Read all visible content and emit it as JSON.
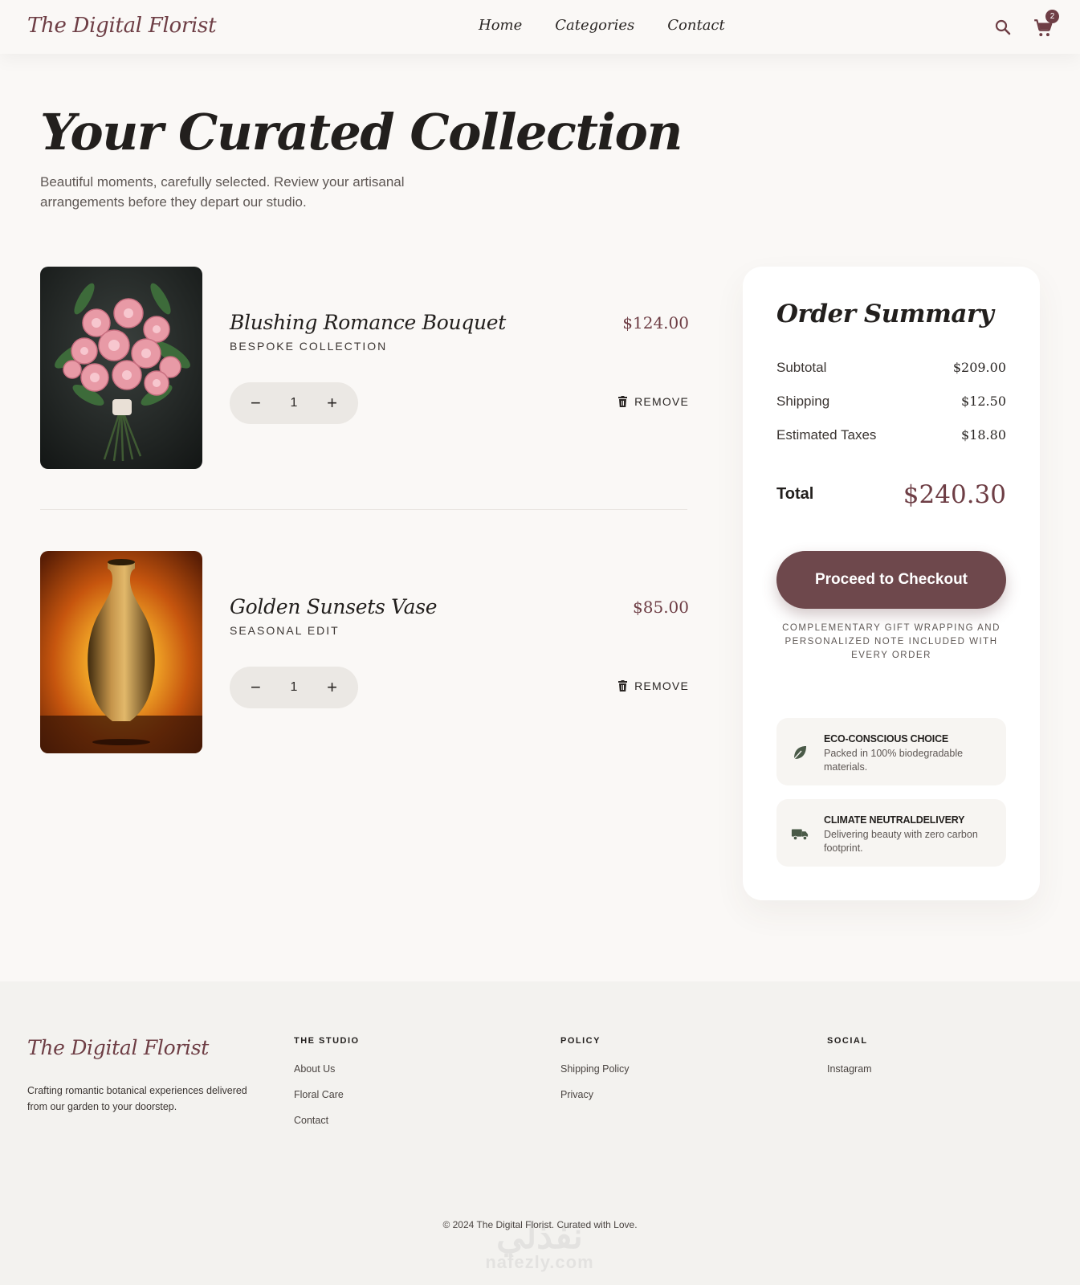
{
  "nav": {
    "brand": "The Digital Florist",
    "links": [
      "Home",
      "Categories",
      "Contact"
    ],
    "cart_count": "2"
  },
  "hero": {
    "title": "Your Curated Collection",
    "subtitle": "Beautiful moments, carefully selected. Review your artisanal arrangements before they depart our studio."
  },
  "cart": {
    "items": [
      {
        "name": "Blushing Romance Bouquet",
        "collection": "BESPOKE COLLECTION",
        "price": "$124.00",
        "quantity": "1",
        "remove_label": "REMOVE",
        "decrement": "−",
        "increment": "+"
      },
      {
        "name": "Golden Sunsets Vase",
        "collection": "SEASONAL EDIT",
        "price": "$85.00",
        "quantity": "1",
        "remove_label": "REMOVE",
        "decrement": "−",
        "increment": "+"
      }
    ]
  },
  "summary": {
    "title": "Order Summary",
    "rows": [
      {
        "label": "Subtotal",
        "value": "$209.00"
      },
      {
        "label": "Shipping",
        "value": "$12.50"
      },
      {
        "label": "Estimated Taxes",
        "value": "$18.80"
      }
    ],
    "total_label": "Total",
    "total_value": "$240.30",
    "checkout_label": "Proceed to Checkout",
    "gift_note": "COMPLEMENTARY GIFT WRAPPING AND PERSONALIZED NOTE INCLUDED WITH EVERY ORDER",
    "badges": [
      {
        "title": "ECO-CONSCIOUS CHOICE",
        "text": "Packed in 100% biodegradable materials.",
        "icon": "leaf-icon"
      },
      {
        "title": "CLIMATE NEUTRALDELIVERY",
        "text": "Delivering beauty with zero carbon footprint.",
        "icon": "truck-icon"
      }
    ]
  },
  "footer": {
    "brand": "The Digital Florist",
    "description": "Crafting romantic botanical experiences delivered from our garden to your doorstep.",
    "columns": [
      {
        "heading": "THE STUDIO",
        "links": [
          "About Us",
          "Floral Care",
          "Contact"
        ]
      },
      {
        "heading": "POLICY",
        "links": [
          "Shipping Policy",
          "Privacy"
        ]
      },
      {
        "heading": "SOCIAL",
        "links": [
          "Instagram"
        ]
      }
    ],
    "copyright": "© 2024 The Digital Florist. Curated with Love."
  },
  "watermark": {
    "arabic": "نفذلي",
    "latin": "nafezly.com"
  },
  "colors": {
    "accent": "#6e3e45",
    "button": "#6e484c",
    "background": "#faf8f6",
    "footer": "#f3f2ef",
    "icon_green": "#4a5a48"
  }
}
